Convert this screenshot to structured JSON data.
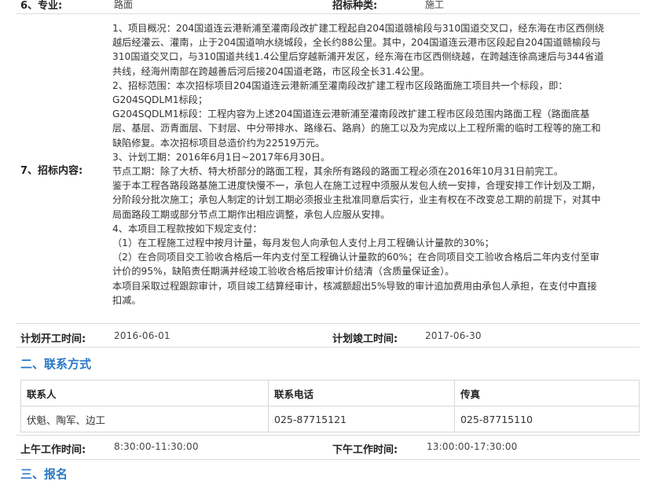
{
  "row6": {
    "label": "6、专业:",
    "value": "路面",
    "label2": "招标种类:",
    "value2": "施工"
  },
  "row7": {
    "label": "7、招标内容:",
    "lines": [
      "1、项目概况：204国道连云港新浦至灌南段改扩建工程起自204国道赣榆段与310国道交叉口，经东海在市区西侧绕",
      "越后经灌云、灌南，止于204国道响水绕城段，全长约88公里。其中，204国道连云港市区段起自204国道赣榆段与",
      "310国道交叉口，与310国道共线1.4公里后穿越新浦开发区，经东海在市区西侧绕越，在跨越连徐高速后与344省道",
      "共线，经海州南部在跨越善后河后接204国道老路，市区段全长31.4公里。",
      "2、招标范围：本次招标项目204国道连云港新浦至灌南段改扩建工程市区段路面施工项目共一个标段，即：",
      "G204SQDLM1标段；",
      "G204SQDLM1标段：工程内容为上述204国道连云港新浦至灌南段改扩建工程市区段范围内路面工程（路面底基",
      "层、基层、沥青面层、下封层、中分带排水、路缘石、路肩）的施工以及为完成以上工程所需的临时工程等的施工和",
      "缺陷修复。本次招标项目总造价约为22519万元。",
      "3、计划工期：2016年6月1日~2017年6月30日。",
      "节点工期：除了大桥、特大桥部分的路面工程，其余所有路段的路面工程必须在2016年10月31日前完工。",
      "鉴于本工程各路段路基施工进度快慢不一，承包人在施工过程中须服从发包人统一安排，合理安排工作计划及工期，",
      "分阶段分批次施工；承包人制定的计划工期必须报业主批准同意后实行，业主有权在不改变总工期的前提下，对其中",
      "局面路段工期或部分节点工期作出相应调整，承包人应服从安排。",
      "4、本项目工程款按如下规定支付：",
      "（1）在工程施工过程中按月计量，每月发包人向承包人支付上月工程确认计量款的30%；",
      "（2）在合同项目交工验收合格后一年内支付至工程确认计量款的60%；在合同项目交工验收合格后二年内支付至审",
      "计价的95%，缺陷责任期满并经竣工验收合格后按审计价结清（含质量保证金）。",
      "本项目采取过程跟踪审计，项目竣工结算经审计，核减额超出5%导致的审计追加费用由承包人承担，在支付中直接",
      "扣减。"
    ]
  },
  "schedule": {
    "start_label": "计划开工时间:",
    "start_value": "2016-06-01",
    "end_label": "计划竣工时间:",
    "end_value": "2017-06-30"
  },
  "section2": {
    "title": "二、联系方式"
  },
  "contact_table": {
    "headers": [
      "联系人",
      "联系电话",
      "传真"
    ],
    "row": [
      "伏魁、陶军、边工",
      "025-87715121",
      "025-87715110"
    ]
  },
  "worktime": {
    "am_label": "上午工作时间:",
    "am_value": "8:30:00-11:30:00",
    "pm_label": "下午工作时间:",
    "pm_value": "13:00:00-17:30:00"
  },
  "section3": {
    "title": "三、报名"
  }
}
